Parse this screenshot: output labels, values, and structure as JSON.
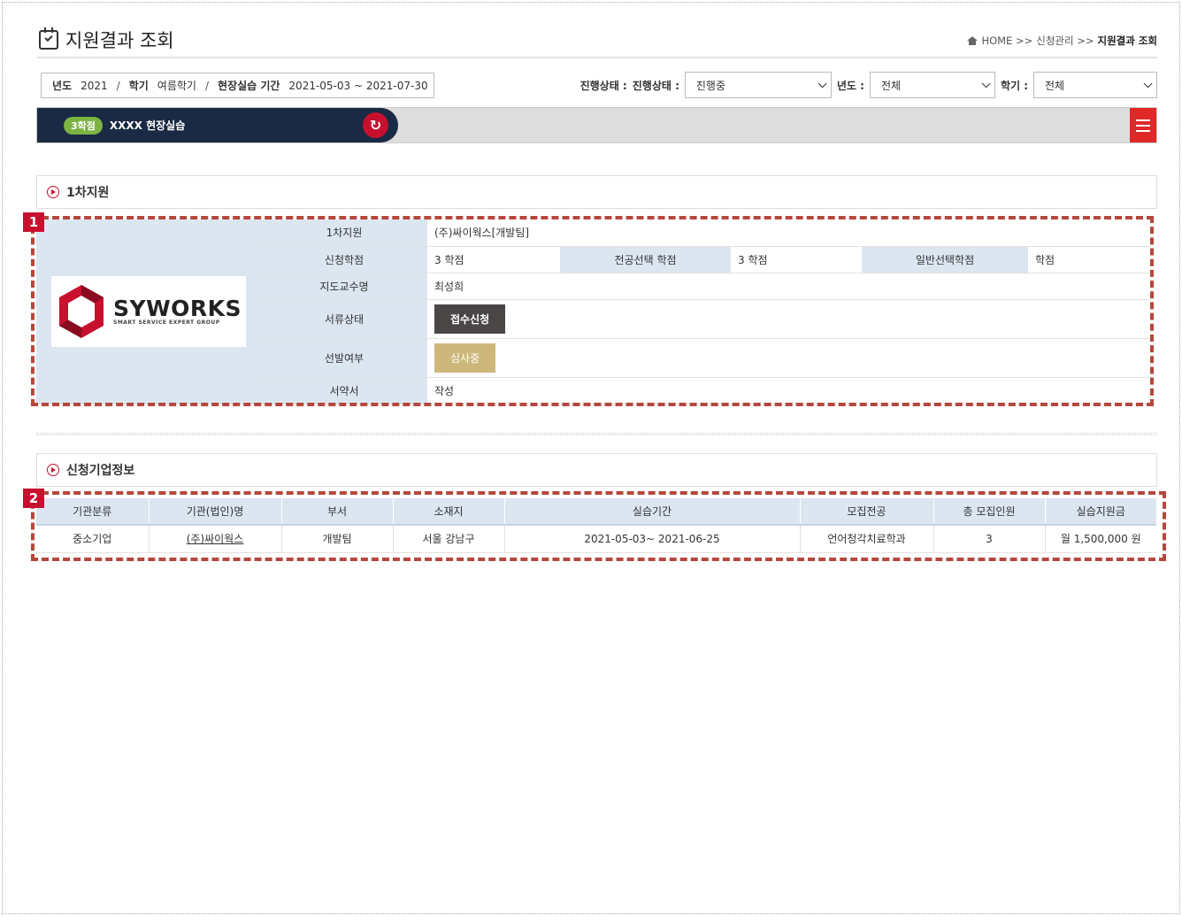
{
  "page": {
    "title": "지원결과 조회",
    "breadcrumb": {
      "home": "HOME >>",
      "middle": "신청관리 >>",
      "current": "지원결과 조회"
    }
  },
  "info": {
    "year_label": "년도",
    "year_value": "2021",
    "semester_label": "학기",
    "semester_value": "여름학기",
    "period_label": "현장실습 기간",
    "period_value": "2021-05-03 ~ 2021-07-30",
    "separator": "/"
  },
  "filters": {
    "progress_prefix": "진행상태 :",
    "progress_label": "진행상태 :",
    "progress_value": "진행중",
    "year_label": "년도 :",
    "year_value": "전체",
    "semester_label": "학기 :",
    "semester_value": "전체"
  },
  "course": {
    "credit_badge": "3학점",
    "name": "XXXX 현장실습"
  },
  "sections": {
    "first": "1차지원",
    "company": "신청기업정보"
  },
  "badges": {
    "one": "1",
    "two": "2"
  },
  "logo": {
    "name": "SYWORKS",
    "tagline": "SMART SERVICE EXPERT GROUP"
  },
  "detail": {
    "first_label": "1차지원",
    "first_value": "(주)싸이웍스[개발팀]",
    "credit_label": "신청학점",
    "credit_value": "3 학점",
    "major_label": "전공선택 학점",
    "major_value": "3 학점",
    "general_label": "일반선택학점",
    "general_value": "학점",
    "professor_label": "지도교수명",
    "professor_value": "최성희",
    "doc_label": "서류상태",
    "doc_value": "접수신청",
    "select_label": "선발여부",
    "select_value": "심사중",
    "pledge_label": "서약서",
    "pledge_value": "작성"
  },
  "company_table": {
    "headers": [
      "기관분류",
      "기관(법인)명",
      "부서",
      "소재지",
      "실습기간",
      "모집전공",
      "총 모집인원",
      "실습지원금"
    ],
    "rows": [
      [
        "중소기업",
        "(주)싸이웍스",
        "개발팀",
        "서울 강남구",
        "2021-05-03~ 2021-06-25",
        "언어청각치료학과",
        "3",
        "월 1,500,000 원"
      ]
    ]
  },
  "colors": {
    "accent": "#c8102e",
    "navy": "#1a2a44",
    "header_bg": "#dce6f1",
    "dashed": "#b5473c"
  }
}
